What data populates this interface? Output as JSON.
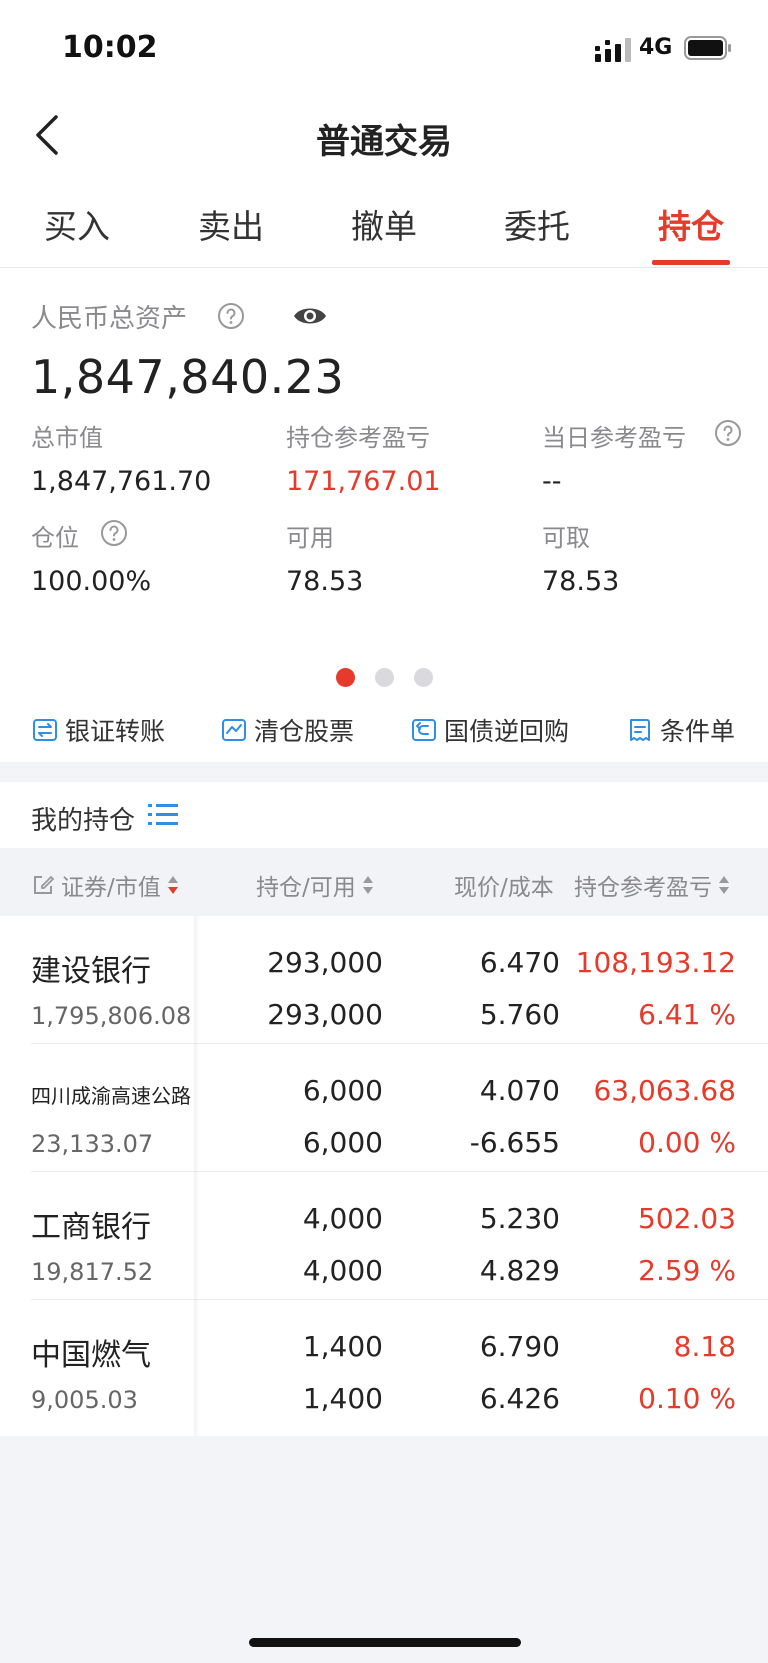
{
  "status_bar": {
    "time": "10:02",
    "network": "4G"
  },
  "nav": {
    "title": "普通交易"
  },
  "tabs": [
    {
      "label": "买入"
    },
    {
      "label": "卖出"
    },
    {
      "label": "撤单"
    },
    {
      "label": "委托"
    },
    {
      "label": "持仓",
      "active": true
    }
  ],
  "assets": {
    "total_label": "人民币总资产",
    "total_value": "1,847,840.23",
    "market_value_label": "总市值",
    "market_value": "1,847,761.70",
    "position_pl_label": "持仓参考盈亏",
    "position_pl": "171,767.01",
    "today_pl_label": "当日参考盈亏",
    "today_pl": "--",
    "position_ratio_label": "仓位",
    "position_ratio": "100.00%",
    "available_label": "可用",
    "available": "78.53",
    "withdrawable_label": "可取",
    "withdrawable": "78.53",
    "page_indicator": {
      "count": 3,
      "active": 0
    }
  },
  "quick_actions": [
    {
      "label": "银证转账",
      "icon": "bank-transfer-icon"
    },
    {
      "label": "清仓股票",
      "icon": "clear-stock-icon"
    },
    {
      "label": "国债逆回购",
      "icon": "reverse-repo-icon"
    },
    {
      "label": "条件单",
      "icon": "condition-order-icon"
    }
  ],
  "holdings": {
    "title": "我的持仓",
    "columns": [
      "证券/市值",
      "持仓/可用",
      "现价/成本",
      "持仓参考盈亏"
    ],
    "rows": [
      {
        "name": "建设银行",
        "market_value": "1,795,806.08",
        "position": "293,000",
        "available": "293,000",
        "price": "6.470",
        "cost": "5.760",
        "pl": "108,193.12",
        "pl_pct": "6.41 %"
      },
      {
        "name": "四川成渝高速公路",
        "market_value": "23,133.07",
        "position": "6,000",
        "available": "6,000",
        "price": "4.070",
        "cost": "-6.655",
        "pl": "63,063.68",
        "pl_pct": "0.00 %"
      },
      {
        "name": "工商银行",
        "market_value": "19,817.52",
        "position": "4,000",
        "available": "4,000",
        "price": "5.230",
        "cost": "4.829",
        "pl": "502.03",
        "pl_pct": "2.59 %"
      },
      {
        "name": "中国燃气",
        "market_value": "9,005.03",
        "position": "1,400",
        "available": "1,400",
        "price": "6.790",
        "cost": "6.426",
        "pl": "8.18",
        "pl_pct": "0.10 %"
      }
    ]
  },
  "colors": {
    "accent": "#e63a2a",
    "icon_blue": "#2f8ee6",
    "muted": "#8a8a8e"
  }
}
